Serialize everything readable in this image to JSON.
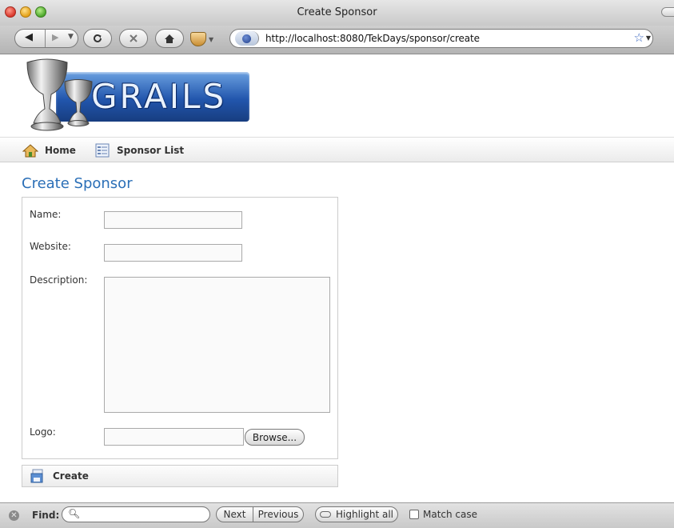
{
  "window": {
    "title": "Create Sponsor"
  },
  "toolbar": {
    "url": "http://localhost:8080/TekDays/sponsor/create"
  },
  "nav": {
    "home_label": "Home",
    "list_label": "Sponsor List"
  },
  "logo": {
    "text": "GRAILS"
  },
  "form": {
    "heading": "Create Sponsor",
    "name_label": "Name:",
    "name_value": "",
    "website_label": "Website:",
    "website_value": "",
    "description_label": "Description:",
    "description_value": "",
    "logo_label": "Logo:",
    "browse_label": "Browse...",
    "create_label": "Create"
  },
  "findbar": {
    "label": "Find:",
    "value": "",
    "next_label": "Next",
    "previous_label": "Previous",
    "highlight_label": "Highlight all",
    "match_case_label": "Match case",
    "match_case_checked": false
  },
  "colors": {
    "heading": "#2b6fb7",
    "logo_blue": "#2256ad"
  }
}
